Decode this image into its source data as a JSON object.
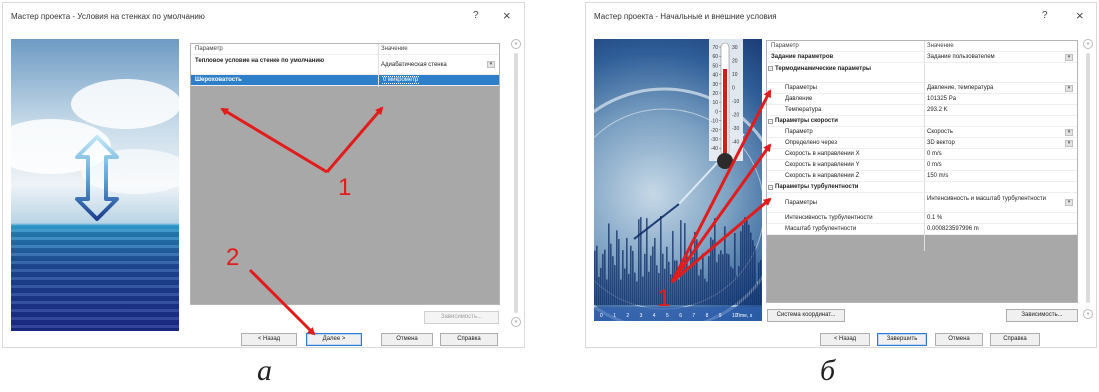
{
  "dialog_a": {
    "title": "Мастер проекта - Условия на стенках по умолчанию",
    "help": "?",
    "close": "×",
    "grid": {
      "header": [
        "Параметр",
        "Значение"
      ],
      "rows": [
        {
          "param": "Тепловое условие на стенке по умолчанию",
          "value": "Адиабатическая стенка"
        },
        {
          "param": "Шероховатость",
          "value": "0 микрометр"
        }
      ]
    },
    "dependency_button": "Зависимость...",
    "buttons": {
      "back": "< Назад",
      "next": "Далее >",
      "cancel": "Отмена",
      "help": "Справка"
    }
  },
  "dialog_b": {
    "title": "Мастер проекта - Начальные и внешние условия",
    "help": "?",
    "close": "×",
    "grid": {
      "header": [
        "Параметр",
        "Значение"
      ],
      "rows": [
        {
          "param": "Задание параметров",
          "value": "Задание пользователем"
        },
        {
          "param": "Термодинамические параметры",
          "value": ""
        },
        {
          "param": "Параметры",
          "value": "Давление, температура"
        },
        {
          "param": "Давление",
          "value": "101325 Pa"
        },
        {
          "param": "Температура",
          "value": "293.2 K"
        },
        {
          "param": "Параметры скорости",
          "value": ""
        },
        {
          "param": "Параметр",
          "value": "Скорость"
        },
        {
          "param": "Определено через",
          "value": "3D вектор"
        },
        {
          "param": "Скорость в направлении X",
          "value": "0 m/s"
        },
        {
          "param": "Скорость в направлении Y",
          "value": "0 m/s"
        },
        {
          "param": "Скорость в направлении Z",
          "value": "150 m/s"
        },
        {
          "param": "Параметры турбулентности",
          "value": ""
        },
        {
          "param": "Параметры",
          "value": "Интенсивность и масштаб турбулентности"
        },
        {
          "param": "Интенсивность турбулентности",
          "value": "0.1 %"
        },
        {
          "param": "Масштаб турбулентности",
          "value": "0.000823597996 m"
        }
      ]
    },
    "thermometer_ticks_left": [
      "70",
      "60",
      "50",
      "40",
      "30",
      "20",
      "10",
      "0",
      "-10",
      "-20",
      "-30",
      "-40"
    ],
    "thermometer_ticks_right": [
      "30",
      "20",
      "10",
      "0",
      "-10",
      "-20",
      "-30",
      "-40"
    ],
    "bottom_ticks": [
      "0",
      "1",
      "2",
      "3",
      "4",
      "5",
      "6",
      "7",
      "8",
      "9",
      "10"
    ],
    "bottom_axis_label": "Time, s",
    "coord_button": "Система координат...",
    "dependency_button": "Зависимость...",
    "buttons": {
      "back": "< Назад",
      "apply": "Завершить",
      "cancel": "Отмена",
      "help": "Справка"
    }
  },
  "annotations": {
    "label_1": "1",
    "label_2": "2",
    "color": "#e21b1b"
  },
  "captions": {
    "a": "а",
    "b": "б"
  }
}
